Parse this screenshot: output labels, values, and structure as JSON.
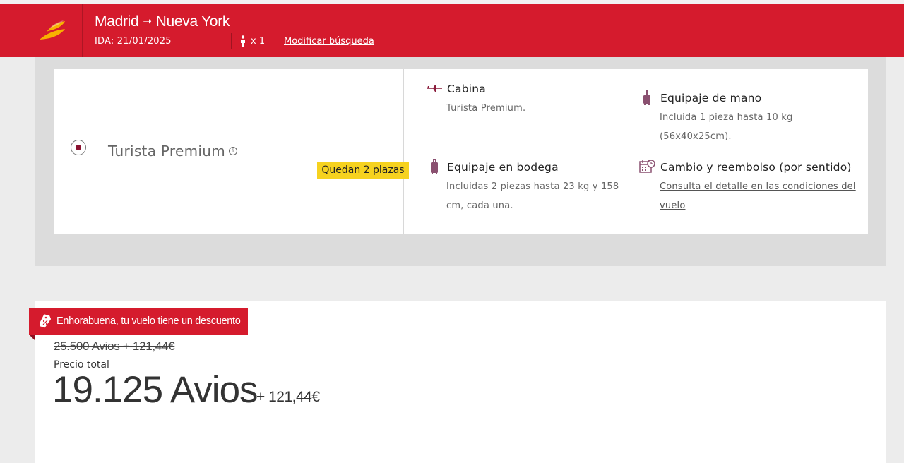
{
  "header": {
    "origin": "Madrid",
    "arrow": "➝",
    "destination": "Nueva York",
    "ida": "IDA: 21/01/2025",
    "passengers": "x 1",
    "modify_label": "Modificar búsqueda",
    "logo_icon": "iberia-logo-icon",
    "brand_color": "#d51b2d"
  },
  "fare": {
    "name": "Turista Premium",
    "seats_left": "Quedan 2 plazas",
    "selected": true,
    "features": {
      "cabin": {
        "title": "Cabina",
        "desc": "Turista Premium.",
        "icon": "plane-icon"
      },
      "carry_on": {
        "title": "Equipaje de mano",
        "desc_line1": "Incluida 1 pieza hasta 10 kg",
        "desc_line2": "(56x40x25cm).",
        "icon": "carry-on-bag-icon"
      },
      "checked": {
        "title": "Equipaje en bodega",
        "desc_line1": "Incluidas 2 piezas hasta 23 kg y 158",
        "desc_line2": "cm, cada una.",
        "icon": "checked-bag-icon"
      },
      "change": {
        "title": "Cambio y reembolso (por sentido)",
        "link_line1": "Consulta el detalle en las condiciones del",
        "link_line2": "vuelo",
        "icon": "calendar-clock-icon"
      }
    }
  },
  "price": {
    "discount_text": "Enhorabuena, tu vuelo tiene un descuento",
    "old_price": "25.500 Avios + 121,44€",
    "total_label": "Precio total",
    "avios": "19.125 Avios",
    "euros": "+ 121,44€"
  }
}
